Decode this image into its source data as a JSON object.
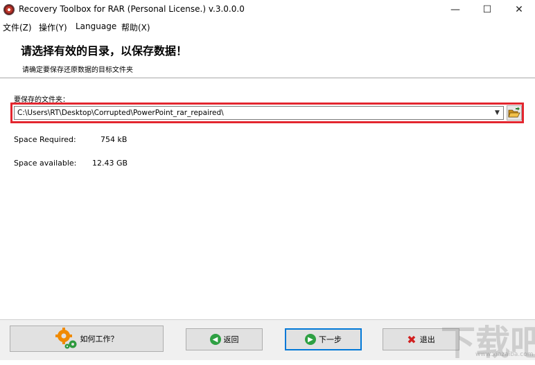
{
  "window": {
    "title": "Recovery Toolbox for RAR (Personal License.) v.3.0.0.0",
    "minimize": "—",
    "maximize": "☐",
    "close": "✕"
  },
  "menu": {
    "items": [
      "文件(Z)",
      "操作(Y)",
      "Language",
      "帮助(X)"
    ]
  },
  "header": {
    "title": "请选择有效的目录，以保存数据！",
    "subtitle": "请确定要保存还原数据的目标文件夹"
  },
  "main": {
    "save_label": "要保存的文件夹：",
    "path_value": "C:\\Users\\RT\\Desktop\\Corrupted\\PowerPoint_rar_repaired\\",
    "space_required_label": "Space Required:",
    "space_required_value": "754 kB",
    "space_available_label": "Space available:",
    "space_available_value": "12.43 GB"
  },
  "footer": {
    "how_label": "如何工作？",
    "back_label": "返回",
    "next_label": "下一步",
    "exit_label": "退出"
  },
  "watermark": {
    "text": "下载吧",
    "url": "www.xiazaiba.com"
  },
  "colors": {
    "highlight_frame": "#e3262f",
    "primary_border": "#0078d7",
    "back_icon": "#2ea043",
    "next_icon": "#2ea043",
    "exit_icon": "#d11f1f",
    "gear_icon": "#f08a00"
  }
}
